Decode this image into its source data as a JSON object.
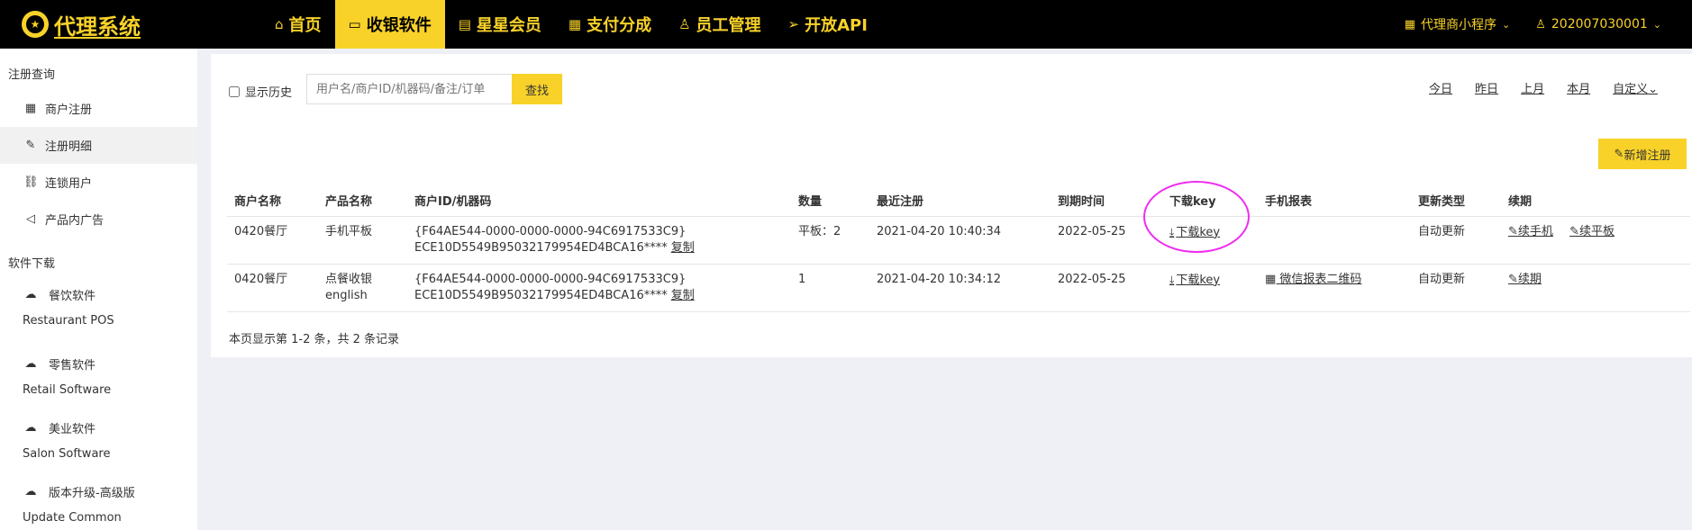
{
  "app": {
    "logo_text": "代理系统",
    "logo_star": "★"
  },
  "nav": {
    "items": [
      {
        "label": "首页",
        "icon": "⌂"
      },
      {
        "label": "收银软件",
        "icon": "▭"
      },
      {
        "label": "星星会员",
        "icon": "▤"
      },
      {
        "label": "支付分成",
        "icon": "▦"
      },
      {
        "label": "员工管理",
        "icon": "♙"
      },
      {
        "label": "开放API",
        "icon": "➢"
      }
    ],
    "right": [
      {
        "label": "代理商小程序",
        "icon": "▦",
        "chev": "⌄"
      },
      {
        "label": "202007030001",
        "icon": "♙",
        "chev": "⌄"
      }
    ]
  },
  "sidebar": {
    "group1": "注册查询",
    "items": [
      {
        "label": "商户注册",
        "icon": "▦"
      },
      {
        "label": "注册明细",
        "icon": "✎"
      },
      {
        "label": "连锁用户",
        "icon": "⛓"
      },
      {
        "label": "产品内广告",
        "icon": "◁"
      }
    ],
    "group2": "软件下载",
    "downloads": [
      {
        "title": "餐饮软件",
        "sub": "Restaurant POS",
        "icon": "☁"
      },
      {
        "title": "零售软件",
        "sub": "Retail Software",
        "icon": "☁"
      },
      {
        "title": "美业软件",
        "sub": "Salon Software",
        "icon": "☁"
      },
      {
        "title": "版本升级-高级版",
        "sub": "Update Common",
        "icon": "☁"
      }
    ]
  },
  "toolbar": {
    "history_label": "显示历史",
    "search_placeholder": "用户名/商户ID/机器码/备注/订单",
    "search_button": "查找",
    "date_links": [
      "今日",
      "昨日",
      "上月",
      "本月",
      "自定义⌄"
    ],
    "add_button": "新增注册",
    "add_icon": "✎"
  },
  "table": {
    "headers": [
      "商户名称",
      "产品名称",
      "商户ID/机器码",
      "数量",
      "最近注册",
      "到期时间",
      "下载key",
      "手机报表",
      "更新类型",
      "续期"
    ],
    "rows": [
      {
        "merchant": "0420餐厅",
        "product": "手机平板",
        "product2": "",
        "id_line1": "{F64AE544-0000-0000-0000-94C6917533C9}",
        "id_line2": "ECE10D5549B95032179954ED4BCA16****",
        "copy": "复制",
        "qty": "平板：2",
        "last_reg": "2021-04-20 10:40:34",
        "expire": "2022-05-25",
        "download": "下载key",
        "mobile_report": "",
        "update_type": "自动更新",
        "renew": [
          "续手机",
          "续平板"
        ]
      },
      {
        "merchant": "0420餐厅",
        "product": "点餐收银",
        "product2": "english",
        "id_line1": "{F64AE544-0000-0000-0000-94C6917533C9}",
        "id_line2": "ECE10D5549B95032179954ED4BCA16****",
        "copy": "复制",
        "qty": "1",
        "last_reg": "2021-04-20 10:34:12",
        "expire": "2022-05-25",
        "download": "下载key",
        "mobile_report": "微信报表二维码",
        "update_type": "自动更新",
        "renew": [
          "续期"
        ]
      }
    ]
  },
  "summary": "本页显示第 1-2 条，共 2 条记录"
}
